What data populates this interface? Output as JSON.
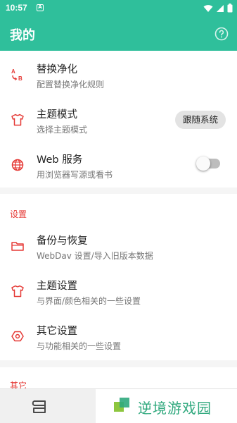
{
  "status_bar": {
    "time": "10:57",
    "notification_glyph": "A",
    "icons": [
      "wifi-icon",
      "signal-icon",
      "battery-icon"
    ]
  },
  "app_bar": {
    "title": "我的",
    "help_icon": "help-circle-icon"
  },
  "top_items": [
    {
      "title": "替换净化",
      "subtitle": "配置替换净化规则",
      "icon": "replace-icon"
    },
    {
      "title": "主题模式",
      "subtitle": "选择主题模式",
      "icon": "tshirt-icon",
      "value": "跟随系统"
    },
    {
      "title": "Web 服务",
      "subtitle": "用浏览器写源或看书",
      "icon": "globe-icon",
      "toggle": false
    }
  ],
  "settings_section": {
    "header": "设置",
    "items": [
      {
        "title": "备份与恢复",
        "subtitle": "WebDav 设置/导入旧版本数据",
        "icon": "folder-icon"
      },
      {
        "title": "主题设置",
        "subtitle": "与界面/颜色相关的一些设置",
        "icon": "tshirt-icon"
      },
      {
        "title": "其它设置",
        "subtitle": "与功能相关的一些设置",
        "icon": "hexagon-settings-icon"
      }
    ]
  },
  "other_section": {
    "header": "其它"
  },
  "watermark": {
    "text": "逆境游戏园",
    "logo_icon": "watermark-logo-icon"
  },
  "bottom_bar": {
    "icon": "bookshelf-nav-icon"
  },
  "colors": {
    "primary": "#2fbf9b",
    "accent_icon": "#e53935",
    "watermark_text": "#2fa87d"
  }
}
